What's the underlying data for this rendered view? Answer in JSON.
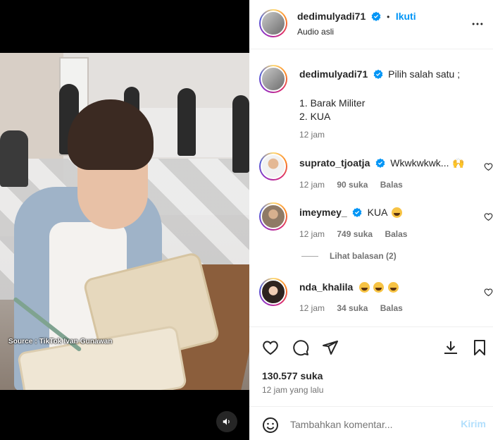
{
  "post": {
    "author": "dedimulyadi71",
    "audio": "Audio asli",
    "follow_label": "Ikuti",
    "bullet": "•",
    "more_icon": "more-horizontal-icon"
  },
  "video": {
    "source_caption": "Source : TikTok Ivan Gunawan",
    "mute_icon": "speaker-icon"
  },
  "caption": {
    "author": "dedimulyadi71",
    "text_line1": "Pilih salah satu ;",
    "text_line2": "1. Barak Militer",
    "text_line3": "2. KUA",
    "time": "12 jam"
  },
  "comments": [
    {
      "user": "suprato_tjoatja",
      "text": "Wkwkwkwk...",
      "time": "12 jam",
      "likes": "90 suka",
      "reply": "Balas"
    },
    {
      "user": "imeymey_",
      "text": "KUA",
      "time": "12 jam",
      "likes": "749 suka",
      "reply": "Balas",
      "view_replies": "Lihat balasan (2)"
    },
    {
      "user": "nda_khalila",
      "text": "",
      "time": "12 jam",
      "likes": "34 suka",
      "reply": "Balas"
    }
  ],
  "stats": {
    "likes": "130.577 suka",
    "posted": "12 jam yang lalu"
  },
  "composer": {
    "placeholder": "Tambahkan komentar...",
    "submit_label": "Kirim"
  },
  "colors": {
    "accent": "#0095f6",
    "verified": "#0095f6",
    "text": "#262626",
    "muted": "#737373"
  }
}
